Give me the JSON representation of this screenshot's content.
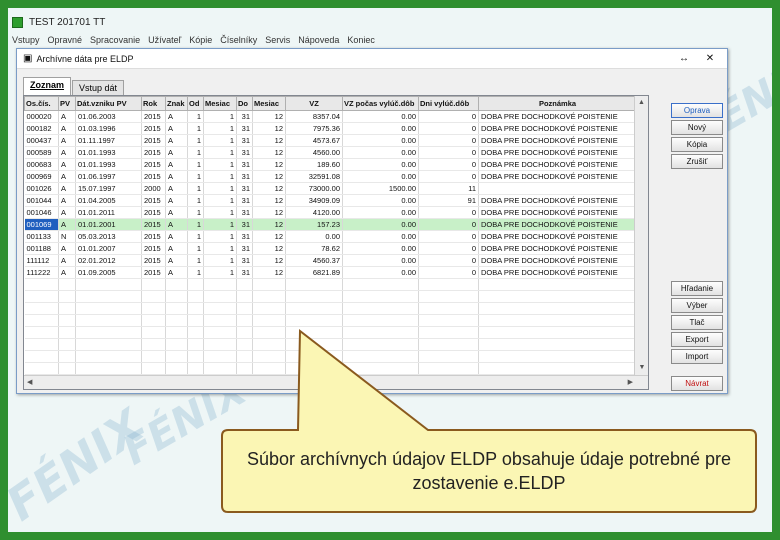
{
  "app": {
    "title": "TEST 201701 TT"
  },
  "menu": [
    "Vstupy",
    "Opravné",
    "Spracovanie",
    "Užívateľ",
    "Kópie",
    "Číselníky",
    "Servis",
    "Nápoveda",
    "Koniec"
  ],
  "window": {
    "title": "Archívne dáta pre ELDP",
    "restore_glyph": "↔",
    "close_glyph": "✕"
  },
  "tabs": [
    "Zoznam",
    "Vstup dát"
  ],
  "grid": {
    "columns": [
      "Os.čís.",
      "PV",
      "Dát.vzniku PV",
      "Rok",
      "Znak",
      "Od",
      "Mesiac",
      "Do",
      "Mesiac",
      "VZ",
      "VZ počas vylúč.dôb",
      "Dni vylúč.dôb",
      "Poznámka"
    ],
    "rows": [
      [
        "000020",
        "A",
        "01.06.2003",
        "2015",
        "A",
        "1",
        "1",
        "31",
        "12",
        "8357.04",
        "0.00",
        "0",
        "DOBA PRE DOCHODKOVÉ POISTENIE"
      ],
      [
        "000182",
        "A",
        "01.03.1996",
        "2015",
        "A",
        "1",
        "1",
        "31",
        "12",
        "7975.36",
        "0.00",
        "0",
        "DOBA PRE DOCHODKOVÉ POISTENIE"
      ],
      [
        "000437",
        "A",
        "01.11.1997",
        "2015",
        "A",
        "1",
        "1",
        "31",
        "12",
        "4573.67",
        "0.00",
        "0",
        "DOBA PRE DOCHODKOVÉ POISTENIE"
      ],
      [
        "000589",
        "A",
        "01.01.1993",
        "2015",
        "A",
        "1",
        "1",
        "31",
        "12",
        "4560.00",
        "0.00",
        "0",
        "DOBA PRE DOCHODKOVÉ POISTENIE"
      ],
      [
        "000683",
        "A",
        "01.01.1993",
        "2015",
        "A",
        "1",
        "1",
        "31",
        "12",
        "189.60",
        "0.00",
        "0",
        "DOBA PRE DOCHODKOVÉ POISTENIE"
      ],
      [
        "000969",
        "A",
        "01.06.1997",
        "2015",
        "A",
        "1",
        "1",
        "31",
        "12",
        "32591.08",
        "0.00",
        "0",
        "DOBA PRE DOCHODKOVÉ POISTENIE"
      ],
      [
        "001026",
        "A",
        "15.07.1997",
        "2000",
        "A",
        "1",
        "1",
        "31",
        "12",
        "73000.00",
        "1500.00",
        "11",
        ""
      ],
      [
        "001044",
        "A",
        "01.04.2005",
        "2015",
        "A",
        "1",
        "1",
        "31",
        "12",
        "34909.09",
        "0.00",
        "91",
        "DOBA PRE DOCHODKOVÉ POISTENIE"
      ],
      [
        "001046",
        "A",
        "01.01.2011",
        "2015",
        "A",
        "1",
        "1",
        "31",
        "12",
        "4120.00",
        "0.00",
        "0",
        "DOBA PRE DOCHODKOVÉ POISTENIE"
      ],
      [
        "001069",
        "A",
        "01.01.2001",
        "2015",
        "A",
        "1",
        "1",
        "31",
        "12",
        "157.23",
        "0.00",
        "0",
        "DOBA PRE DOCHODKOVÉ POISTENIE"
      ],
      [
        "001133",
        "N",
        "05.03.2013",
        "2015",
        "A",
        "1",
        "1",
        "31",
        "12",
        "0.00",
        "0.00",
        "0",
        "DOBA PRE DOCHODKOVÉ POISTENIE"
      ],
      [
        "001188",
        "A",
        "01.01.2007",
        "2015",
        "A",
        "1",
        "1",
        "31",
        "12",
        "78.62",
        "0.00",
        "0",
        "DOBA PRE DOCHODKOVÉ POISTENIE"
      ],
      [
        "111112",
        "A",
        "02.01.2012",
        "2015",
        "A",
        "1",
        "1",
        "31",
        "12",
        "4560.37",
        "0.00",
        "0",
        "DOBA PRE DOCHODKOVÉ POISTENIE"
      ],
      [
        "111222",
        "A",
        "01.09.2005",
        "2015",
        "A",
        "1",
        "1",
        "31",
        "12",
        "6821.89",
        "0.00",
        "0",
        "DOBA PRE DOCHODKOVÉ POISTENIE"
      ]
    ],
    "selected_row": 9
  },
  "buttons": {
    "oprava": "Oprava",
    "novy": "Nový",
    "kopia": "Kópia",
    "zrusit": "Zrušiť",
    "hladanie": "Hľadanie",
    "vyber": "Výber",
    "tlac": "Tlač",
    "export": "Export",
    "import": "Import",
    "navrat": "Návrat"
  },
  "callout": {
    "text": "Súbor archívnych údajov ELDP obsahuje údaje potrebné pre zostavenie e.ELDP"
  },
  "colors": {
    "frame": "#2f8f2f",
    "selection": "#c8f0c8",
    "callout_fill": "#fbf6b4",
    "callout_border": "#8a5a1e"
  }
}
